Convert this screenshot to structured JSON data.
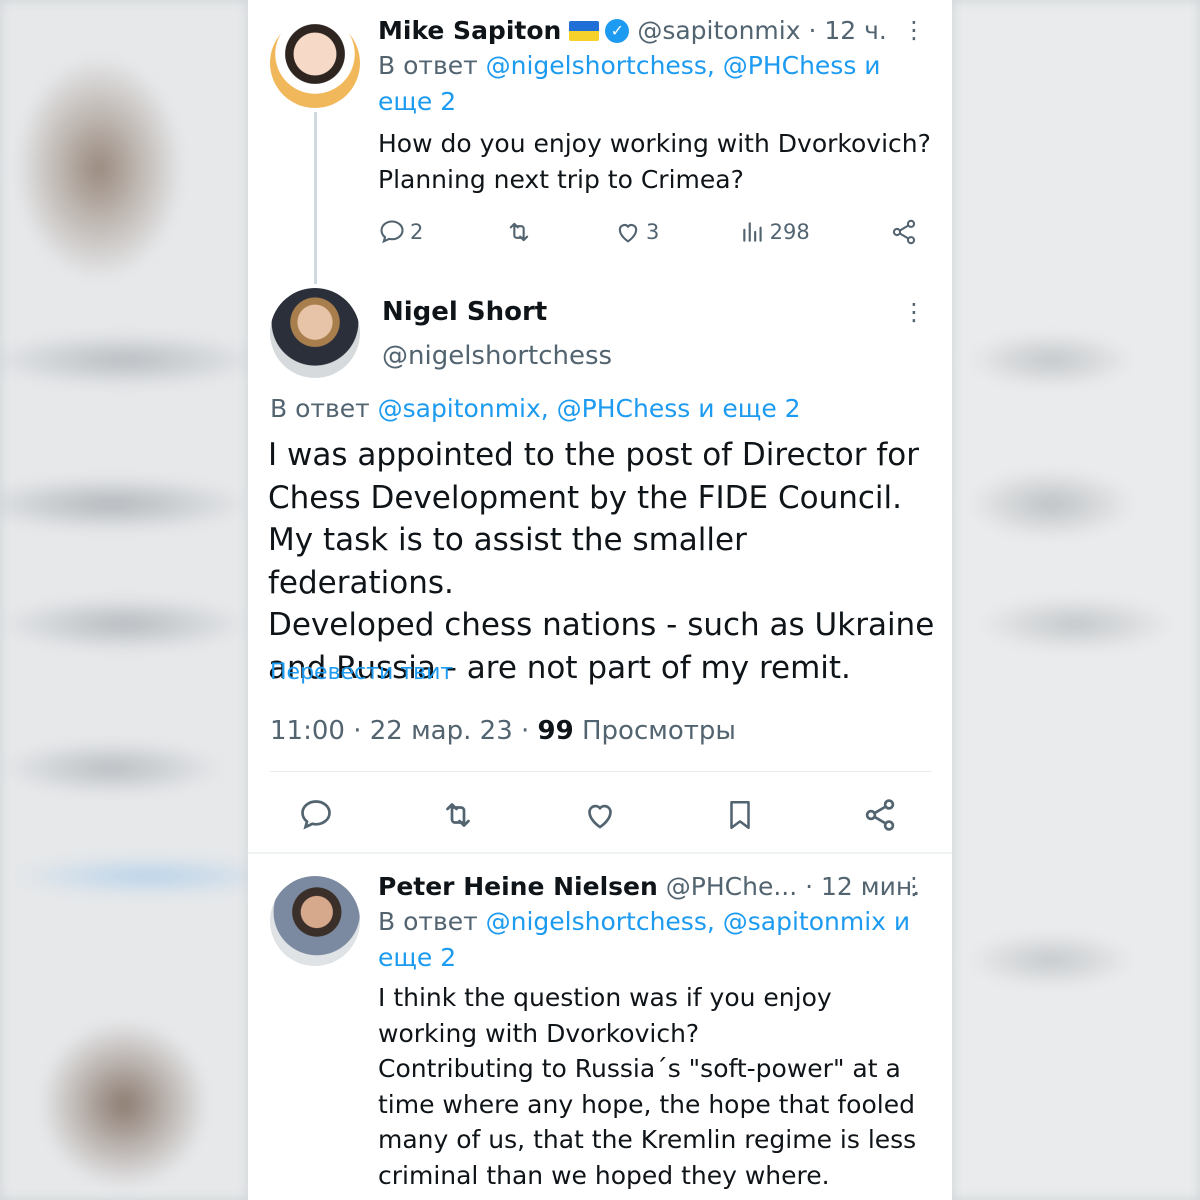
{
  "tweet1": {
    "name": "Mike Sapiton",
    "handle_time": "@sapitonmix · 12 ч.",
    "reply_prefix": "В ответ",
    "reply_targets": "@nigelshortchess, @PHChess и",
    "reply_more": "еще 2",
    "text_line1": "How do you enjoy working with Dvorkovich?",
    "text_line2": "Planning next trip to Crimea?",
    "replies": "2",
    "likes": "3",
    "views": "298"
  },
  "tweet2": {
    "name": "Nigel Short",
    "handle": "@nigelshortchess",
    "reply_prefix": "В ответ",
    "reply_targets": "@sapitonmix, @PHChess и еще 2",
    "text_lines": [
      "I was appointed to the post of Director for",
      "Chess Development by the FIDE Council.",
      "My task is to assist the smaller federations.",
      "Developed chess nations - such as Ukraine",
      "and Russia - are not part of my remit."
    ],
    "translate_label": "Перевести твит",
    "time_date": "11:00 · 22 мар. 23 ·",
    "views_count": "99",
    "views_label": "Просмотры"
  },
  "tweet3": {
    "name": "Peter Heine Nielsen",
    "handle_time": "@PHChe... · 12 мин.",
    "reply_prefix": "В ответ",
    "reply_targets": "@nigelshortchess, @sapitonmix и",
    "reply_more": "еще 2",
    "text_lines": [
      "I think the question was if you enjoy",
      "working with Dvorkovich?",
      "Contributing to Russia´s \"soft-power\" at a",
      "time where any hope, the hope that fooled",
      "many of us, that the Kremlin regime is less",
      "criminal than we hoped they where."
    ]
  },
  "colors": {
    "accent": "#1d9bf0",
    "muted": "#536471",
    "text": "#0f1419"
  },
  "icons": [
    "reply-icon",
    "retweet-icon",
    "like-icon",
    "views-icon",
    "share-icon",
    "bookmark-icon",
    "more-icon",
    "verified-icon",
    "ukraine-flag-icon"
  ]
}
